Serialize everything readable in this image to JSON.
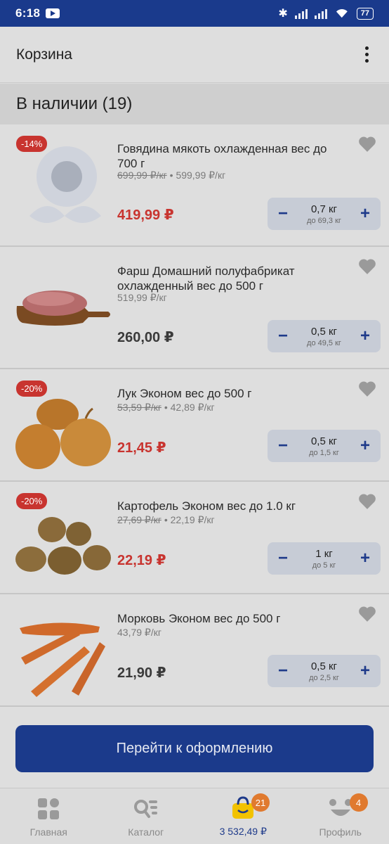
{
  "status_bar": {
    "time": "6:18",
    "battery": "77"
  },
  "header": {
    "title": "Корзина"
  },
  "section": {
    "title": "В наличии (19)"
  },
  "items": [
    {
      "badge": "-14%",
      "name": "Говядина мякоть охлажденная вес до 700 г",
      "old_unit_price": "699,99 ₽/кг",
      "sep": "•",
      "unit_price": "599,99 ₽/кг",
      "price": "419,99 ₽",
      "qty": "0,7 кг",
      "max": "до 69,3 кг",
      "image": "placeholder-flower-icon"
    },
    {
      "badge": "",
      "name": "Фарш Домашний полуфабрикат охлажденный вес до 500 г",
      "old_unit_price": "",
      "sep": "",
      "unit_price": "519,99 ₽/кг",
      "price": "260,00 ₽",
      "qty": "0,5 кг",
      "max": "до 49,5 кг",
      "image": "minced-meat-board"
    },
    {
      "badge": "-20%",
      "name": "Лук  Эконом вес до 500 г",
      "old_unit_price": "53,59 ₽/кг",
      "sep": "•",
      "unit_price": "42,89 ₽/кг",
      "price": "21,45 ₽",
      "qty": "0,5 кг",
      "max": "до 1,5 кг",
      "image": "onions"
    },
    {
      "badge": "-20%",
      "name": "Картофель  Эконом вес до 1.0 кг",
      "old_unit_price": "27,69 ₽/кг",
      "sep": "•",
      "unit_price": "22,19 ₽/кг",
      "price": "22,19 ₽",
      "qty": "1 кг",
      "max": "до 5 кг",
      "image": "potatoes"
    },
    {
      "badge": "",
      "name": "Морковь  Эконом вес до 500 г",
      "old_unit_price": "",
      "sep": "",
      "unit_price": "43,79 ₽/кг",
      "price": "21,90 ₽",
      "qty": "0,5 кг",
      "max": "до 2,5 кг",
      "image": "carrots"
    }
  ],
  "checkout": {
    "label": "Перейти к оформлению"
  },
  "bottom_nav": [
    {
      "label": "Главная",
      "icon": "home-grid-icon",
      "badge": ""
    },
    {
      "label": "Каталог",
      "icon": "catalog-search-icon",
      "badge": ""
    },
    {
      "label": "3 532,49 ₽",
      "icon": "cart-bag-icon",
      "badge": "21"
    },
    {
      "label": "Профиль",
      "icon": "profile-face-icon",
      "badge": "4"
    }
  ],
  "colors": {
    "brand": "#1b3a8b",
    "sale": "#c8342f",
    "badge": "#e07a2f"
  }
}
